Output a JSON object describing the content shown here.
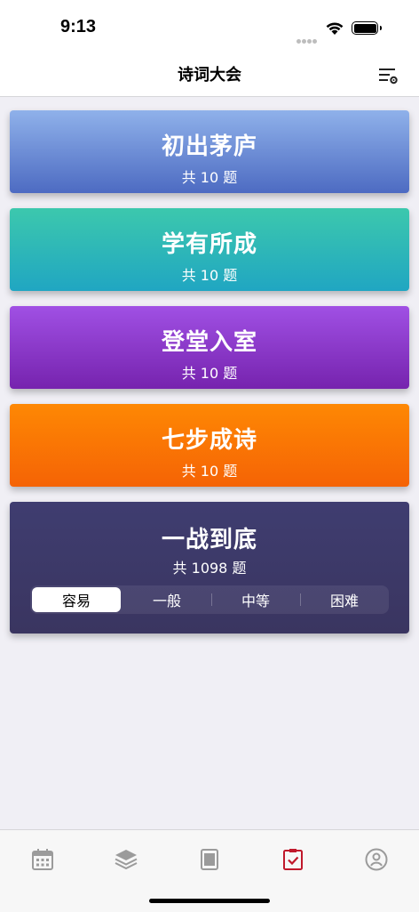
{
  "status": {
    "time": "9:13"
  },
  "nav": {
    "title": "诗词大会",
    "settings_icon": "list-settings-icon"
  },
  "cards": [
    {
      "title": "初出茅庐",
      "count": "共 10 题",
      "colors": [
        "#8fb1ea",
        "#4d6bc2"
      ]
    },
    {
      "title": "学有所成",
      "count": "共 10 题",
      "colors": [
        "#3cc8ad",
        "#20a6c2"
      ]
    },
    {
      "title": "登堂入室",
      "count": "共 10 题",
      "colors": [
        "#a050e4",
        "#7623ae"
      ]
    },
    {
      "title": "七步成诗",
      "count": "共 10 题",
      "colors": [
        "#fe8804",
        "#f56305"
      ]
    }
  ],
  "challenge": {
    "title": "一战到底",
    "count": "共 1098 题",
    "levels": [
      "容易",
      "一般",
      "中等",
      "困难"
    ],
    "selected_level": "容易"
  },
  "tabs": [
    {
      "icon": "calendar-icon",
      "active": false
    },
    {
      "icon": "layers-icon",
      "active": false
    },
    {
      "icon": "book-icon",
      "active": false
    },
    {
      "icon": "quiz-checklist-icon",
      "active": true
    },
    {
      "icon": "profile-icon",
      "active": false
    }
  ],
  "colors": {
    "tab_active": "#c0182b",
    "tab_inactive": "#9b9b9b"
  }
}
